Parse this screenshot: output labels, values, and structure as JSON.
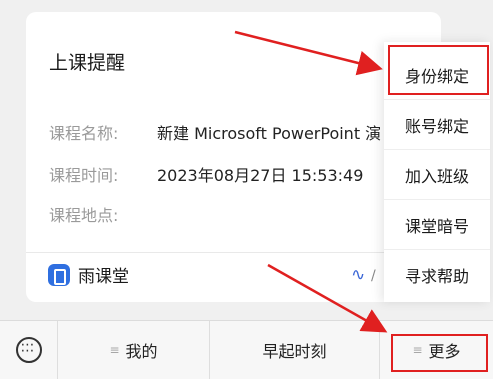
{
  "card": {
    "title": "上课提醒",
    "fields": [
      {
        "key": "课程名称:",
        "value": "新建 Microsoft PowerPoint 演"
      },
      {
        "key": "课程时间:",
        "value": "2023年08月27日 15:53:49"
      },
      {
        "key": "课程地点:",
        "value": ""
      }
    ],
    "footer": {
      "brand": "雨课堂",
      "link_tail": "/"
    }
  },
  "menu": {
    "items": [
      "身份绑定",
      "账号绑定",
      "加入班级",
      "课堂暗号",
      "寻求帮助"
    ]
  },
  "bottombar": {
    "tabs": [
      "我的",
      "早起时刻",
      "更多"
    ]
  },
  "colors": {
    "annotation_red": "#e02020",
    "brand_blue": "#2f6fe0"
  },
  "icons": {
    "keyboard": "keyboard-icon",
    "menu": "hamburger-icon",
    "link": "link-icon",
    "brand": "yuketang-logo-icon"
  }
}
